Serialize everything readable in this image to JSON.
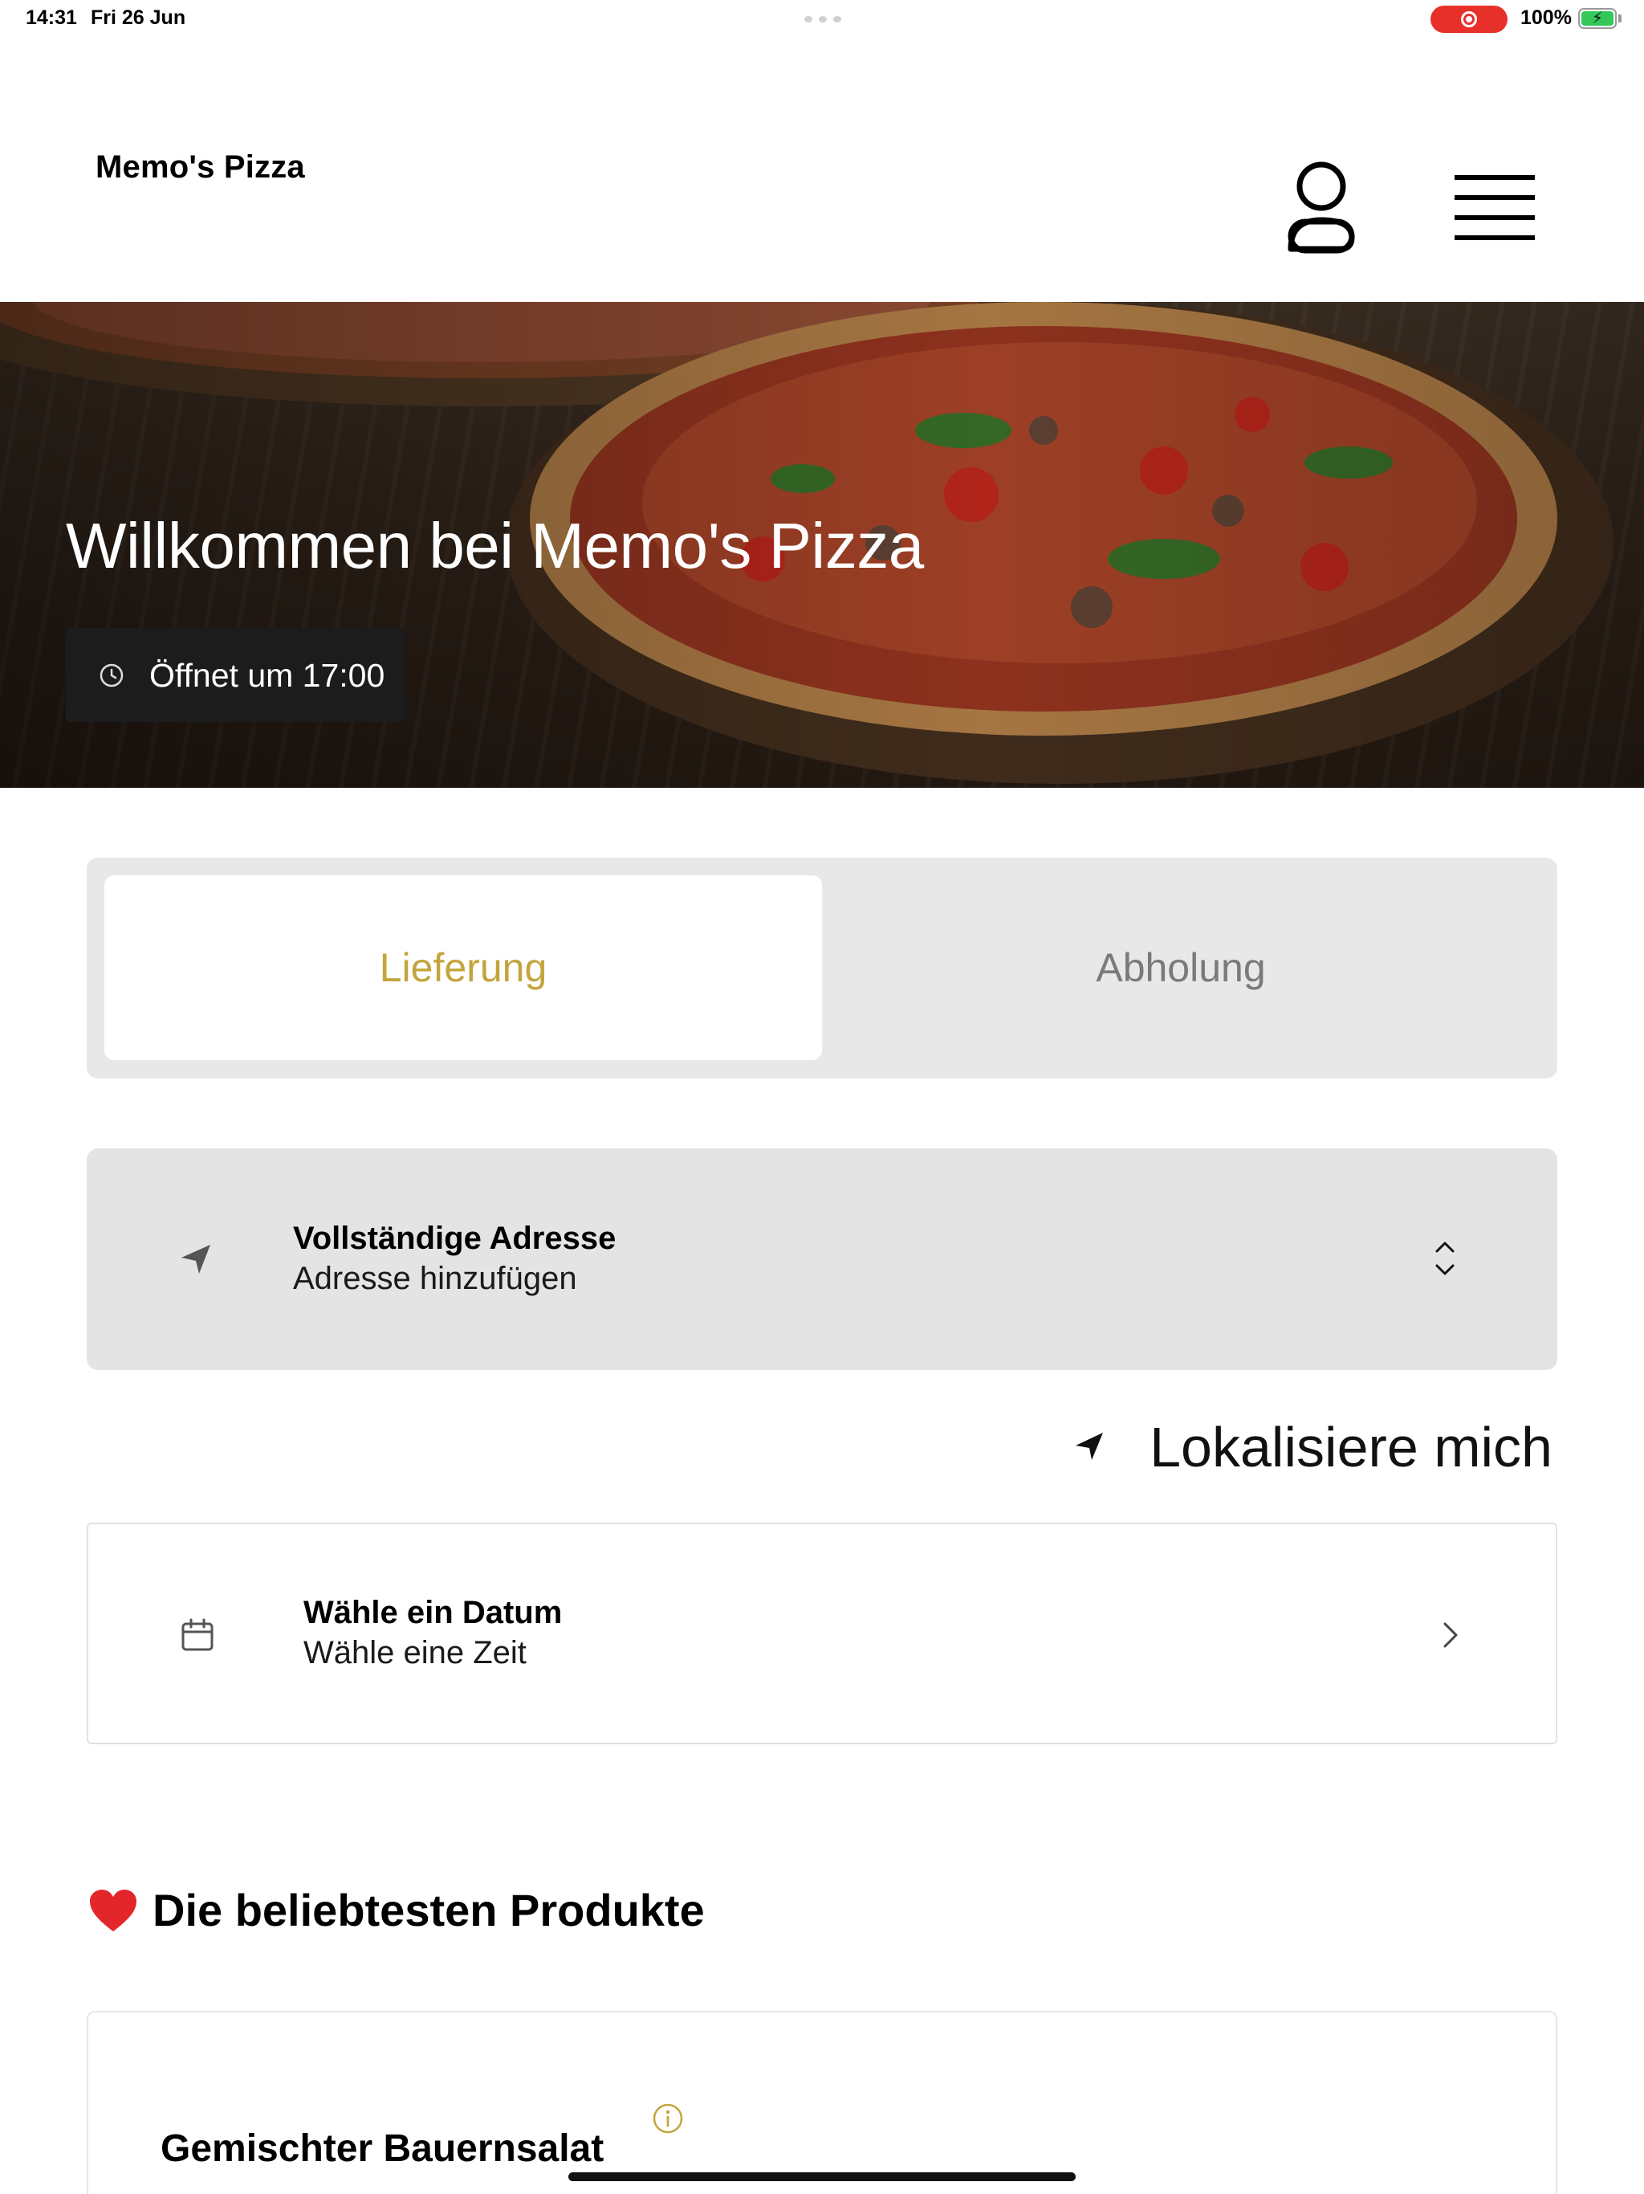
{
  "status_bar": {
    "time": "14:31",
    "date": "Fri 26 Jun",
    "battery": "100%"
  },
  "header": {
    "brand": "Memo's Pizza",
    "icons": [
      "user-icon",
      "menu-icon"
    ]
  },
  "hero": {
    "title": "Willkommen bei Memo's Pizza",
    "hours": "Öffnet um 17:00"
  },
  "order_mode": {
    "options": [
      "Lieferung",
      "Abholung"
    ],
    "selected": "Lieferung",
    "accent_color": "#c4a43d"
  },
  "address": {
    "title": "Vollständige Adresse",
    "subtitle": "Adresse hinzufügen"
  },
  "locate": {
    "label": "Lokalisiere mich"
  },
  "schedule": {
    "title": "Wähle ein Datum",
    "subtitle": "Wähle eine Zeit"
  },
  "popular": {
    "title": "Die beliebtesten Produkte",
    "products": [
      {
        "name": "Gemischter Bauernsalat"
      }
    ]
  }
}
